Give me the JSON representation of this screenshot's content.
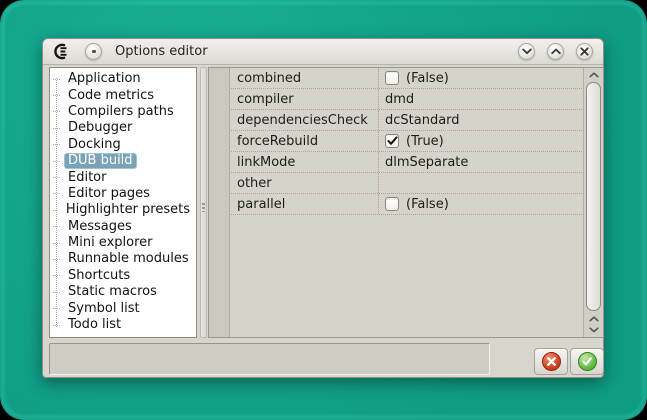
{
  "window": {
    "title": "Options editor"
  },
  "sidebar": {
    "items": [
      {
        "label": "Application",
        "selected": false
      },
      {
        "label": "Code metrics",
        "selected": false
      },
      {
        "label": "Compilers paths",
        "selected": false
      },
      {
        "label": "Debugger",
        "selected": false
      },
      {
        "label": "Docking",
        "selected": false
      },
      {
        "label": "DUB build",
        "selected": true
      },
      {
        "label": "Editor",
        "selected": false
      },
      {
        "label": "Editor pages",
        "selected": false
      },
      {
        "label": "Highlighter presets",
        "selected": false
      },
      {
        "label": "Messages",
        "selected": false
      },
      {
        "label": "Mini explorer",
        "selected": false
      },
      {
        "label": "Runnable modules",
        "selected": false
      },
      {
        "label": "Shortcuts",
        "selected": false
      },
      {
        "label": "Static macros",
        "selected": false
      },
      {
        "label": "Symbol list",
        "selected": false
      },
      {
        "label": "Todo list",
        "selected": false
      }
    ]
  },
  "grid": {
    "rows": [
      {
        "name": "combined",
        "type": "bool",
        "checked": false,
        "value": "(False)"
      },
      {
        "name": "compiler",
        "type": "text",
        "value": "dmd"
      },
      {
        "name": "dependenciesCheck",
        "type": "text",
        "value": "dcStandard"
      },
      {
        "name": "forceRebuild",
        "type": "bool",
        "checked": true,
        "value": "(True)"
      },
      {
        "name": "linkMode",
        "type": "text",
        "value": "dlmSeparate"
      },
      {
        "name": "other",
        "type": "text",
        "value": ""
      },
      {
        "name": "parallel",
        "type": "bool",
        "checked": false,
        "value": "(False)"
      }
    ]
  },
  "icons": {
    "app_logo": "coedit-logo",
    "window_menu": "menu-dot",
    "minimize": "chevron-down",
    "maximize": "chevron-up",
    "close": "x",
    "scroll_up": "chevron-up",
    "scroll_down": "chevron-down",
    "cancel": "x-circle-red",
    "ok": "check-circle-green",
    "checkbox_checked": "check"
  },
  "colors": {
    "desktop_teal": "#12a18b",
    "selection_blue": "#7ba3b8",
    "cancel_red": "#d14224",
    "ok_green": "#64bf46",
    "window_bg": "#d8d5cd",
    "panel_white": "#ffffff"
  }
}
